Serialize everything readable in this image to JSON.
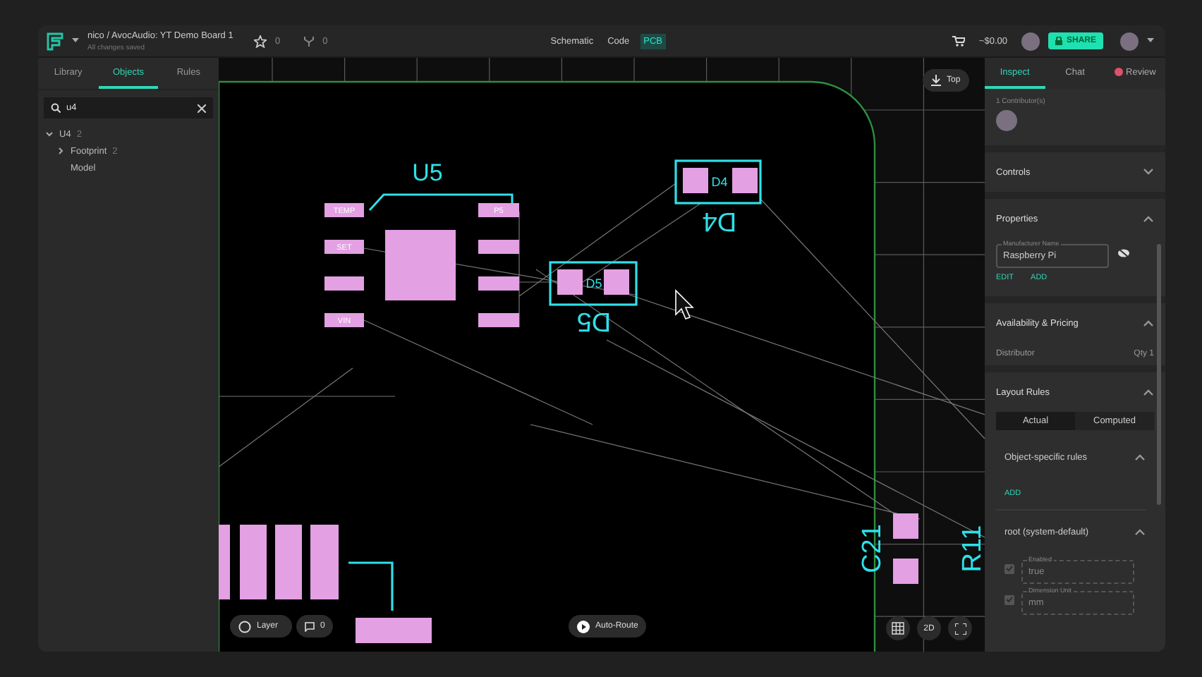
{
  "header": {
    "project": "nico / AvocAudio: YT Demo Board 1",
    "status": "All changes saved",
    "stars": "0",
    "forks": "0",
    "views": [
      {
        "label": "Schematic",
        "selected": false
      },
      {
        "label": "Code",
        "selected": false
      },
      {
        "label": "PCB",
        "selected": true
      }
    ],
    "price": "~$0.00",
    "share": "SHARE"
  },
  "left_panel": {
    "tabs": [
      {
        "label": "Library",
        "selected": false
      },
      {
        "label": "Objects",
        "selected": true
      },
      {
        "label": "Rules",
        "selected": false
      }
    ],
    "search": {
      "value": "u4"
    },
    "tree": [
      {
        "label": "U4",
        "count": "2",
        "expanded": true,
        "children": [
          {
            "label": "Footprint",
            "count": "2",
            "expanded": false
          },
          {
            "label": "Model"
          }
        ]
      }
    ]
  },
  "canvas": {
    "side_button": "Top",
    "designators": [
      "U5",
      "D4",
      "D5",
      "C21",
      "R11"
    ],
    "pad_labels": [
      "TEMP",
      "SET",
      "VIN",
      "P5"
    ],
    "inner_labels": [
      "D4",
      "D5"
    ],
    "layer_button": "Layer",
    "comments": "0",
    "autoroute": "Auto-Route",
    "view_mode": "2D"
  },
  "right_panel": {
    "tabs": [
      {
        "label": "Inspect",
        "selected": true
      },
      {
        "label": "Chat",
        "selected": false
      },
      {
        "label": "Review",
        "selected": false
      }
    ],
    "contributors": "1 Contributor(s)",
    "sections": [
      {
        "title": "Controls",
        "expanded": false
      },
      {
        "title": "Properties",
        "expanded": true,
        "field": {
          "label": "Manufacturer Name",
          "value": "Raspberry Pi"
        },
        "actions": [
          "EDIT",
          "ADD"
        ]
      },
      {
        "title": "Availability & Pricing",
        "expanded": true,
        "row": {
          "label": "Distributor",
          "value": "Qty 1"
        }
      },
      {
        "title": "Layout Rules",
        "expanded": true,
        "modes": [
          {
            "label": "Actual",
            "selected": true
          },
          {
            "label": "Computed",
            "selected": false
          }
        ],
        "groups": [
          {
            "title": "Object-specific rules",
            "expanded": true,
            "action": "ADD"
          },
          {
            "title": "root (system-default)",
            "expanded": true,
            "rules": [
              {
                "label": "Enabled",
                "value": "true",
                "checked": true,
                "disabled": true
              },
              {
                "label": "Dimension Unit",
                "value": "mm",
                "checked": true,
                "disabled": true
              }
            ]
          }
        ]
      }
    ]
  }
}
